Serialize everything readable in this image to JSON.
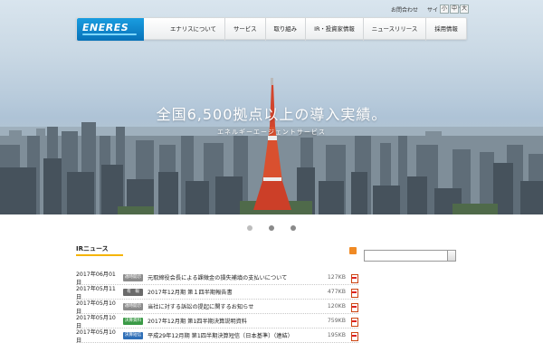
{
  "utility": {
    "contact": "お問合わせ",
    "sitemap": "サイトマップ",
    "font_small": "小",
    "font_medium": "中",
    "font_large": "大"
  },
  "logo": {
    "text": "ENERES"
  },
  "nav": [
    {
      "label": "エナリスについて"
    },
    {
      "label": "サービス"
    },
    {
      "label": "取り組み"
    },
    {
      "label": "IR・投資家情報"
    },
    {
      "label": "ニュースリリース"
    },
    {
      "label": "採用情報"
    }
  ],
  "hero": {
    "headline": "全国6,500拠点以上の導入実績。",
    "subline": "エネルギーエージェントサービス",
    "slides": 3,
    "active_slide": 2
  },
  "ir_news": {
    "title": "IRニュース",
    "items": [
      {
        "date": "2017年06月01日",
        "badge": "適時開示",
        "badge_color": "#8c8c8c",
        "title": "元取締役会長による課徴金の損失補填の支払いについて",
        "size": "127KB"
      },
      {
        "date": "2017年05月11日",
        "badge": "有　報",
        "badge_color": "#6b6b6b",
        "title": "2017年12月期 第１四半期報告書",
        "size": "477KB"
      },
      {
        "date": "2017年05月10日",
        "badge": "適時開示",
        "badge_color": "#8c8c8c",
        "title": "当社に対する訴訟の提起に関するお知らせ",
        "size": "120KB"
      },
      {
        "date": "2017年05月10日",
        "badge": "決算資料",
        "badge_color": "#3a9a46",
        "title": "2017年12月期 第1四半期決算説明資料",
        "size": "759KB"
      },
      {
        "date": "2017年05月10日",
        "badge": "決算短信",
        "badge_color": "#2f6fb7",
        "title": "平成29年12月期 第1四半期決算短信〔日本基準〕（連結）",
        "size": "195KB"
      }
    ]
  },
  "colors": {
    "brand": "#0a84cc",
    "accent": "#f5b400"
  }
}
